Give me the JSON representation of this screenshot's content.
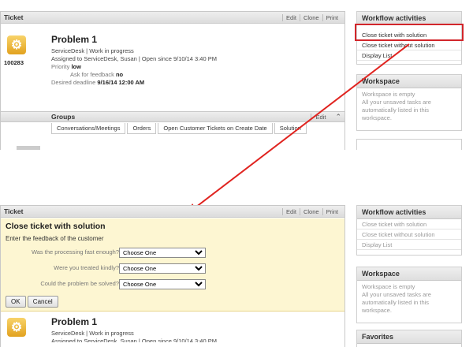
{
  "top": {
    "ticket_title": "Ticket",
    "actions": [
      "Edit",
      "Clone",
      "Print"
    ],
    "problem_title": "Problem 1",
    "ticket_number": "100283",
    "line1": "ServiceDesk | Work in progress",
    "line2": "Assigned to ServiceDesk, Susan | Open since 9/10/14 3:40 PM",
    "priority_label": "Priority",
    "priority_value": "low",
    "feedback_label": "Ask for feedback",
    "feedback_value": "no",
    "deadline_label": "Desired deadline",
    "deadline_value": "9/16/14 12:00 AM",
    "groups_title": "Groups",
    "groups_edit": "Edit",
    "groups_tabs": [
      "Conversations/Meetings",
      "Orders",
      "Open Customer Tickets on Create Date",
      "Solution"
    ]
  },
  "top_side": {
    "workflow_title": "Workflow activities",
    "items": [
      "Close ticket with solution",
      "Close ticket without solution",
      "Display List"
    ],
    "workspace_title": "Workspace",
    "workspace_text": [
      "Workspace is empty",
      "All your unsaved tasks are",
      "automatically listed in this",
      "workspace."
    ]
  },
  "bottom": {
    "ticket_title": "Ticket",
    "actions": [
      "Edit",
      "Clone",
      "Print"
    ],
    "dialog_title": "Close ticket with solution",
    "dialog_subtitle": "Enter the feedback of the customer",
    "questions": [
      {
        "label": "Was the processing fast enough?",
        "value": "Choose One"
      },
      {
        "label": "Were you treated kindly?",
        "value": "Choose One"
      },
      {
        "label": "Could the problem be solved?",
        "value": "Choose One"
      }
    ],
    "ok_label": "OK",
    "cancel_label": "Cancel",
    "problem_title": "Problem 1",
    "line1": "ServiceDesk | Work in progress",
    "line2": "Assigned to ServiceDesk, Susan | Open since 9/10/14 3:40 PM"
  },
  "bottom_side": {
    "workflow_title": "Workflow activities",
    "items": [
      "Close ticket with solution",
      "Close ticket without solution",
      "Display List"
    ],
    "workspace_title": "Workspace",
    "workspace_text": [
      "Workspace is empty",
      "All your unsaved tasks are",
      "automatically listed in this",
      "workspace."
    ],
    "favorites_title": "Favorites"
  },
  "colors": {
    "highlight": "#d2262b",
    "dialog_bg": "#fdf6d2",
    "dialog_border": "#e8d58a",
    "arrow": "#e0231f"
  }
}
